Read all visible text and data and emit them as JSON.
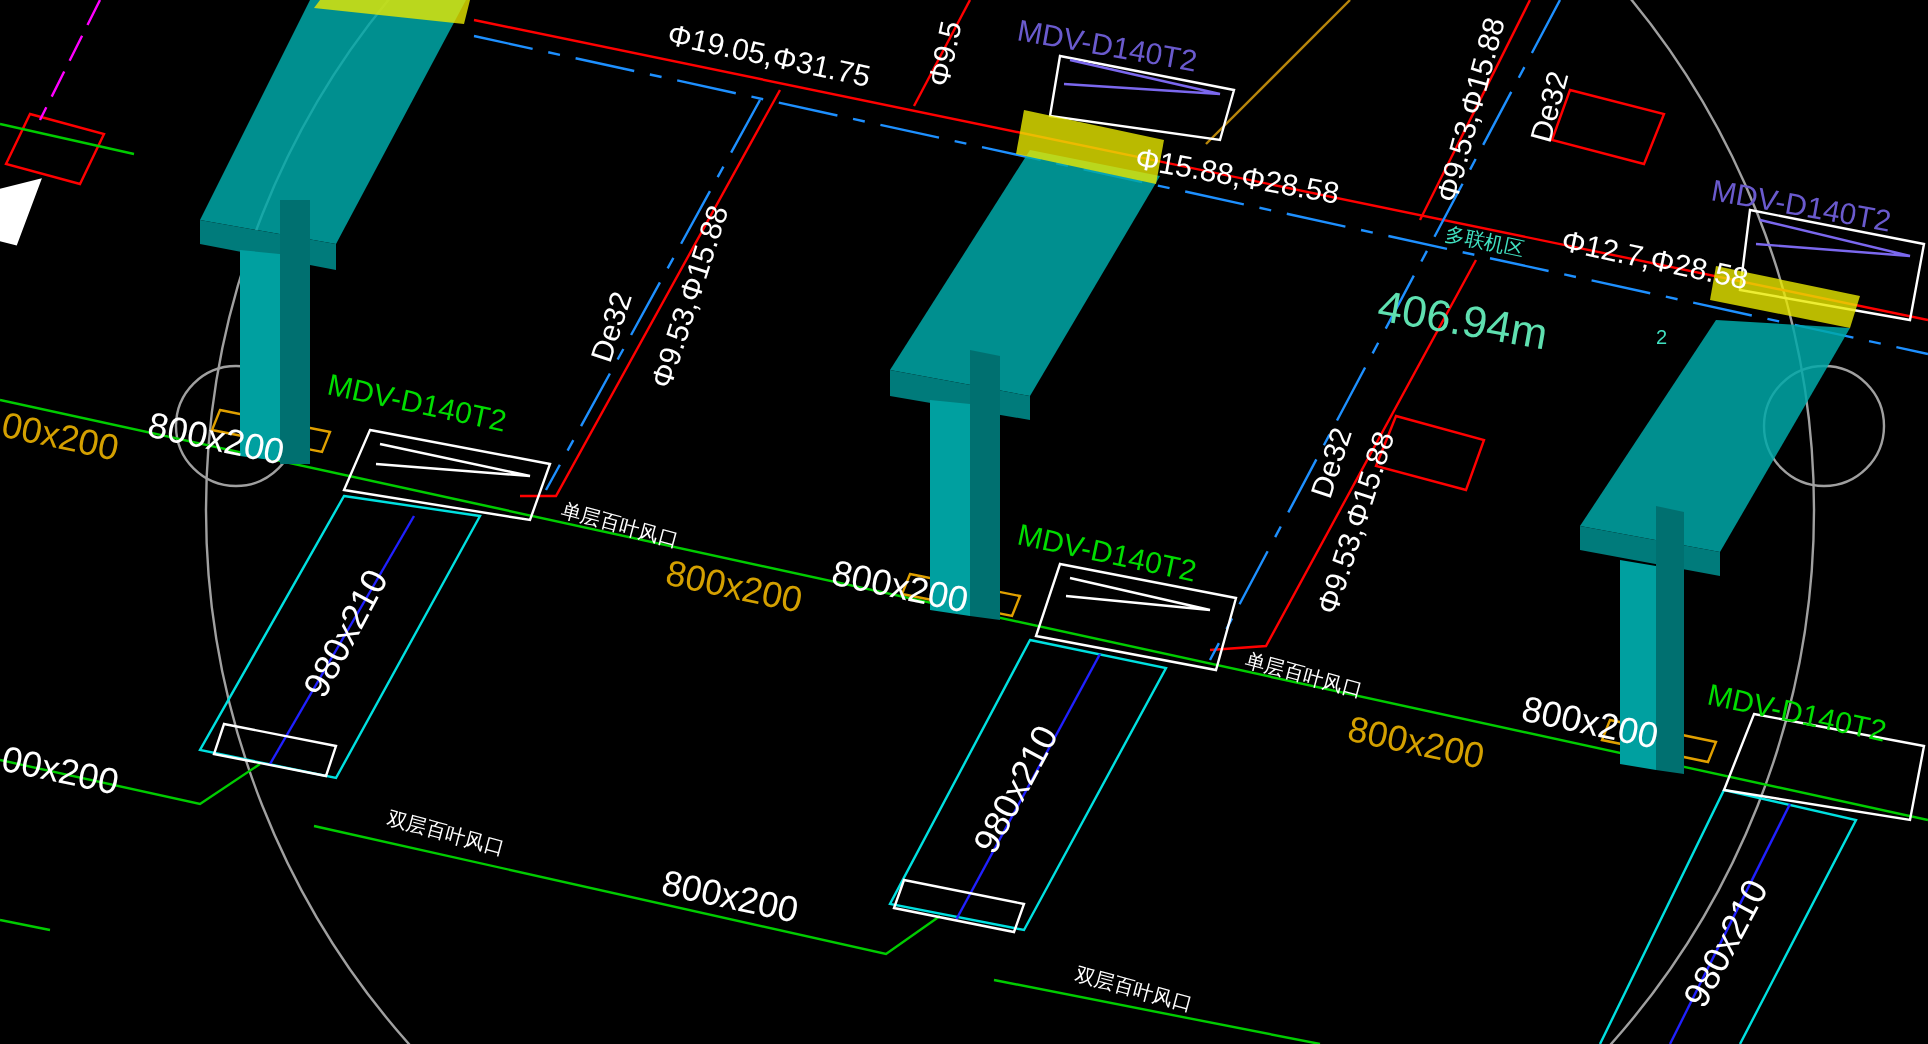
{
  "drawing": {
    "labels": [
      {
        "kind": "pipe",
        "text": "Φ9.5",
        "color": "#ffffff"
      },
      {
        "kind": "pipe",
        "text": "Φ19.05,Φ31.75",
        "color": "#ffffff"
      },
      {
        "kind": "model",
        "text": "MDV-D140T2",
        "color": "#6a5acd"
      },
      {
        "kind": "pipe",
        "text": "Φ15.88,Φ28.58",
        "color": "#ffffff"
      },
      {
        "kind": "pipe",
        "text": "Φ9.53,Φ15.88",
        "color": "#ffffff"
      },
      {
        "kind": "pipe",
        "text": "De32",
        "color": "#ffffff"
      },
      {
        "kind": "model",
        "text": "MDV-D140T2",
        "color": "#6a5acd"
      },
      {
        "kind": "note",
        "text": "多联机区",
        "color": "#40e0c0"
      },
      {
        "kind": "pipe",
        "text": "Φ12.7,Φ28.58",
        "color": "#ffffff"
      },
      {
        "kind": "length",
        "text": "406.94m",
        "color": "#5fe0b0"
      },
      {
        "kind": "note",
        "text": "2",
        "color": "#40e0c0"
      },
      {
        "kind": "pipe",
        "text": "De32",
        "color": "#ffffff"
      },
      {
        "kind": "pipe",
        "text": "Φ9.53,Φ15.88",
        "color": "#ffffff"
      },
      {
        "kind": "model",
        "text": "MDV-D140T2",
        "color": "#00dd00"
      },
      {
        "kind": "duct",
        "text": "00x200",
        "color": "#d4a000"
      },
      {
        "kind": "duct",
        "text": "800x200",
        "color": "#ffffff"
      },
      {
        "kind": "outlet",
        "text": "单层百叶风口",
        "color": "#ffffff"
      },
      {
        "kind": "duct",
        "text": "800x200",
        "color": "#d4a000"
      },
      {
        "kind": "duct",
        "text": "800x200",
        "color": "#ffffff"
      },
      {
        "kind": "model",
        "text": "MDV-D140T2",
        "color": "#00dd00"
      },
      {
        "kind": "outlet",
        "text": "单层百叶风口",
        "color": "#ffffff"
      },
      {
        "kind": "pipe",
        "text": "De32",
        "color": "#ffffff"
      },
      {
        "kind": "pipe",
        "text": "Φ9.53,Φ15.88",
        "color": "#ffffff"
      },
      {
        "kind": "duct",
        "text": "800x200",
        "color": "#d4a000"
      },
      {
        "kind": "duct",
        "text": "800x200",
        "color": "#ffffff"
      },
      {
        "kind": "model",
        "text": "MDV-D140T2",
        "color": "#00dd00"
      },
      {
        "kind": "duct",
        "text": "00x200",
        "color": "#ffffff"
      },
      {
        "kind": "duct",
        "text": "980x210",
        "color": "#ffffff"
      },
      {
        "kind": "duct",
        "text": "980x210",
        "color": "#ffffff"
      },
      {
        "kind": "duct",
        "text": "980x210",
        "color": "#ffffff"
      },
      {
        "kind": "outlet",
        "text": "双层百叶风口",
        "color": "#ffffff"
      },
      {
        "kind": "duct",
        "text": "800x200",
        "color": "#ffffff"
      },
      {
        "kind": "outlet",
        "text": "双层百叶风口",
        "color": "#ffffff"
      }
    ]
  }
}
